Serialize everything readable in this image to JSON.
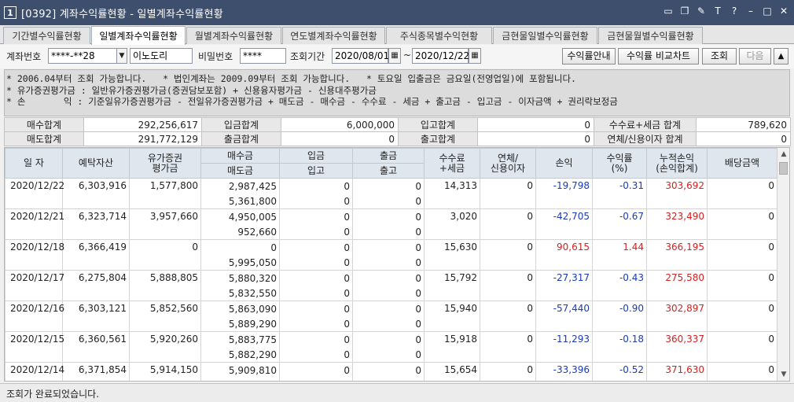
{
  "window": {
    "number": "1",
    "title": "[0392] 계좌수익률현황 - 일별계좌수익률현황"
  },
  "tabs": [
    "기간별수익률현황",
    "일별계좌수익률현황",
    "월별계좌수익률현황",
    "연도별계좌수익률현황",
    "주식종목별수익현황",
    "금현물일별수익률현황",
    "금현물월별수익률현황"
  ],
  "active_tab": 1,
  "query": {
    "account_label": "계좌번호",
    "account_value": "****-**28",
    "account_name": "이노도리",
    "password_label": "비밀번호",
    "password_value": "****",
    "period_label": "조회기간",
    "date_from": "2020/08/01",
    "date_sep": "~",
    "date_to": "2020/12/22",
    "btn_guide": "수익률안내",
    "btn_compare": "수익률 비교차트",
    "btn_query": "조회",
    "btn_next": "다음"
  },
  "notes": [
    "* 2006.04부터 조회 가능합니다.   * 법인계좌는 2009.09부터 조회 가능합니다.   * 토요일 입출금은 금요일(전영업일)에 포함됩니다.",
    "* 유가증권평가금 : 일반유가증권평가금(증권담보포함) + 신용융자평가금 - 신용대주평가금",
    "* 손       익 : 기준일유가증권평가금 - 전일유가증권평가금 + 매도금 - 매수금 - 수수료 - 세금 + 출고금 - 입고금 - 이자금액 + 권리락보정금"
  ],
  "summary": {
    "row1": [
      {
        "label": "매수합계",
        "value": "292,256,617"
      },
      {
        "label": "입금합계",
        "value": "6,000,000"
      },
      {
        "label": "입고합계",
        "value": "0"
      },
      {
        "label": "수수료+세금 합계",
        "value": "789,620"
      }
    ],
    "row2": [
      {
        "label": "매도합계",
        "value": "291,772,129"
      },
      {
        "label": "출금합계",
        "value": "0"
      },
      {
        "label": "출고합계",
        "value": "0"
      },
      {
        "label": "연체/신용이자 합계",
        "value": "0"
      }
    ]
  },
  "grid": {
    "headers": {
      "date": "일 자",
      "deposit": "예탁자산",
      "securities": "유가증권\n평가금",
      "buy": "매수금",
      "sell": "매도금",
      "in_money": "입금",
      "in_stock": "입고",
      "out_money": "출금",
      "out_stock": "출고",
      "fee": "수수료\n+세금",
      "interest": "연체/\n신용이자",
      "pnl": "손익",
      "rate": "수익률\n(%)",
      "cum": "누적손익\n(손익합계)",
      "dividend": "배당금액"
    },
    "rows": [
      {
        "date": "2020/12/22",
        "deposit": "6,303,916",
        "securities": "1,577,800",
        "buy": "2,987,425",
        "sell": "5,361,800",
        "in_money": "0",
        "in_stock": "0",
        "out_money": "0",
        "out_stock": "0",
        "fee": "14,313",
        "interest": "0",
        "pnl": "-19,798",
        "rate": "-0.31",
        "cum": "303,692",
        "dividend": "0",
        "sign": "neg"
      },
      {
        "date": "2020/12/21",
        "deposit": "6,323,714",
        "securities": "3,957,660",
        "buy": "4,950,005",
        "sell": "952,660",
        "in_money": "0",
        "in_stock": "0",
        "out_money": "0",
        "out_stock": "0",
        "fee": "3,020",
        "interest": "0",
        "pnl": "-42,705",
        "rate": "-0.67",
        "cum": "323,490",
        "dividend": "0",
        "sign": "neg"
      },
      {
        "date": "2020/12/18",
        "deposit": "6,366,419",
        "securities": "0",
        "buy": "0",
        "sell": "5,995,050",
        "in_money": "0",
        "in_stock": "0",
        "out_money": "0",
        "out_stock": "0",
        "fee": "15,630",
        "interest": "0",
        "pnl": "90,615",
        "rate": "1.44",
        "cum": "366,195",
        "dividend": "0",
        "sign": "pos"
      },
      {
        "date": "2020/12/17",
        "deposit": "6,275,804",
        "securities": "5,888,805",
        "buy": "5,880,320",
        "sell": "5,832,550",
        "in_money": "0",
        "in_stock": "0",
        "out_money": "0",
        "out_stock": "0",
        "fee": "15,792",
        "interest": "0",
        "pnl": "-27,317",
        "rate": "-0.43",
        "cum": "275,580",
        "dividend": "0",
        "sign": "neg"
      },
      {
        "date": "2020/12/16",
        "deposit": "6,303,121",
        "securities": "5,852,560",
        "buy": "5,863,090",
        "sell": "5,889,290",
        "in_money": "0",
        "in_stock": "0",
        "out_money": "0",
        "out_stock": "0",
        "fee": "15,940",
        "interest": "0",
        "pnl": "-57,440",
        "rate": "-0.90",
        "cum": "302,897",
        "dividend": "0",
        "sign": "neg"
      },
      {
        "date": "2020/12/15",
        "deposit": "6,360,561",
        "securities": "5,920,260",
        "buy": "5,883,775",
        "sell": "5,882,290",
        "in_money": "0",
        "in_stock": "0",
        "out_money": "0",
        "out_stock": "0",
        "fee": "15,918",
        "interest": "0",
        "pnl": "-11,293",
        "rate": "-0.18",
        "cum": "360,337",
        "dividend": "0",
        "sign": "neg"
      },
      {
        "date": "2020/12/14",
        "deposit": "6,371,854",
        "securities": "5,914,150",
        "buy": "5,909,810",
        "sell": "",
        "in_money": "0",
        "in_stock": "",
        "out_money": "0",
        "out_stock": "",
        "fee": "15,654",
        "interest": "0",
        "pnl": "-33,396",
        "rate": "-0.52",
        "cum": "371,630",
        "dividend": "0",
        "sign": "neg"
      }
    ]
  },
  "status": "조회가 완료되었습니다.",
  "colors": {
    "titlebar": "#3d4f6c",
    "negative": "#1a3bb5",
    "positive": "#d42222",
    "header_bg": "#dfe6ee"
  }
}
